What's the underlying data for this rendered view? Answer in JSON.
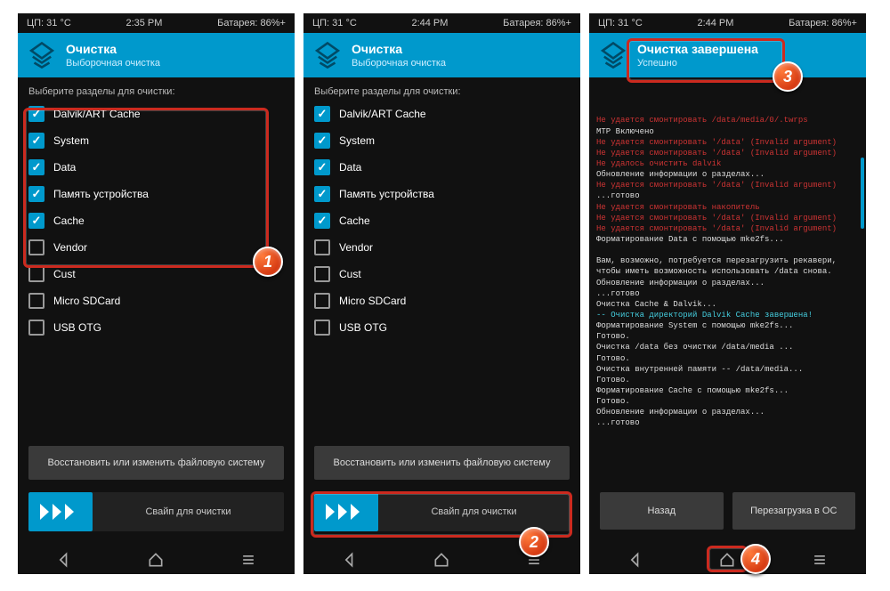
{
  "status": {
    "cpu": "ЦП: 31 °C",
    "time1": "2:35 PM",
    "time2": "2:44 PM",
    "time3": "2:44 PM",
    "batt": "Батарея: 86%+"
  },
  "header1": {
    "title": "Очистка",
    "sub": "Выборочная очистка"
  },
  "header3": {
    "title": "Очистка завершена",
    "sub": "Успешно"
  },
  "instruct": "Выберите разделы для очистки:",
  "partitions": [
    {
      "label": "Dalvik/ART Cache",
      "checked": true
    },
    {
      "label": "System",
      "checked": true
    },
    {
      "label": "Data",
      "checked": true
    },
    {
      "label": "Память устройства",
      "checked": true
    },
    {
      "label": "Cache",
      "checked": true
    },
    {
      "label": "Vendor",
      "checked": false
    },
    {
      "label": "Cust",
      "checked": false
    },
    {
      "label": "Micro SDCard",
      "checked": false
    },
    {
      "label": "USB OTG",
      "checked": false
    }
  ],
  "buttons": {
    "repair": "Восстановить или изменить файловую систему",
    "swipe": "Свайп для очистки",
    "back": "Назад",
    "reboot": "Перезагрузка в ОС"
  },
  "log": [
    {
      "cls": "err",
      "t": "Не удается смонтировать /data/media/0/.twrps"
    },
    {
      "cls": "ok",
      "t": "MTP Включено"
    },
    {
      "cls": "err",
      "t": "Не удается смонтировать '/data' (Invalid argument)"
    },
    {
      "cls": "err",
      "t": "Не удается смонтировать '/data' (Invalid argument)"
    },
    {
      "cls": "err",
      "t": "Не удалось очистить dalvik"
    },
    {
      "cls": "ok",
      "t": "Обновление информации о разделах..."
    },
    {
      "cls": "err",
      "t": "Не удается смонтировать '/data' (Invalid argument)"
    },
    {
      "cls": "ok",
      "t": "...готово"
    },
    {
      "cls": "err",
      "t": "Не удается смонтировать накопитель"
    },
    {
      "cls": "err",
      "t": "Не удается смонтировать '/data' (Invalid argument)"
    },
    {
      "cls": "err",
      "t": "Не удается смонтировать '/data' (Invalid argument)"
    },
    {
      "cls": "ok",
      "t": "Форматирование Data с помощью mke2fs..."
    },
    {
      "cls": "ok",
      "t": " "
    },
    {
      "cls": "ok",
      "t": "Вам, возможно, потребуется перезагрузить рекавери, чтобы иметь возможность использовать /data снова."
    },
    {
      "cls": "ok",
      "t": "Обновление информации о разделах..."
    },
    {
      "cls": "ok",
      "t": "...готово"
    },
    {
      "cls": "ok",
      "t": "Очистка Cache & Dalvik..."
    },
    {
      "cls": "cy",
      "t": "-- Очистка директорий Dalvik Cache завершена!"
    },
    {
      "cls": "ok",
      "t": "Форматирование System с помощью mke2fs..."
    },
    {
      "cls": "ok",
      "t": "Готово."
    },
    {
      "cls": "ok",
      "t": "Очистка /data без очистки /data/media ..."
    },
    {
      "cls": "ok",
      "t": "Готово."
    },
    {
      "cls": "ok",
      "t": "Очистка внутренней памяти -- /data/media..."
    },
    {
      "cls": "ok",
      "t": "Готово."
    },
    {
      "cls": "ok",
      "t": "Форматирование Cache с помощью mke2fs..."
    },
    {
      "cls": "ok",
      "t": "Готово."
    },
    {
      "cls": "ok",
      "t": "Обновление информации о разделах..."
    },
    {
      "cls": "ok",
      "t": "...готово"
    }
  ]
}
